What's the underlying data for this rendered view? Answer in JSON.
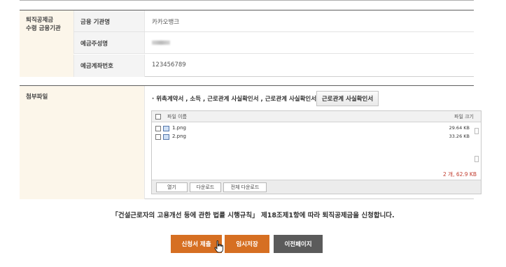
{
  "bank_section": {
    "header": "퇴직공제금\n수령 금융기관",
    "rows": [
      {
        "label": "금융 기관명",
        "value": "카카오뱅크"
      },
      {
        "label": "예금주성명",
        "value": ""
      },
      {
        "label": "예금계좌번호",
        "value": "123456789"
      }
    ]
  },
  "attachment_section": {
    "header": "첨부파일",
    "doc_list": "· 위촉계약서 , 소득 , 근로관계 사실확인서 , 근로관계 사실확인서",
    "doc_button": "근로관계 사실확인서",
    "file_table": {
      "col_name": "파일 이름",
      "col_size": "파일 크기",
      "files": [
        {
          "name": "1.png",
          "size": "29.64 KB"
        },
        {
          "name": "2.png",
          "size": "33.26 KB"
        }
      ],
      "total": "2 개, 62.9 KB"
    },
    "actions": {
      "open": "열기",
      "download": "다운로드",
      "download_all": "전체 다운로드"
    }
  },
  "notice": "「건설근로자의 고용개선 등에 관한 법률 시행규칙」 제18조제1항에 따라 퇴직공제금을 신청합니다.",
  "buttons": {
    "submit": "신청서 제출",
    "save_temp": "임시저장",
    "prev": "이전페이지"
  },
  "colors": {
    "accent": "#d66f22",
    "secondary": "#5b5b5b",
    "header_bg": "#fcf6ea",
    "total_text": "#c0392b"
  }
}
